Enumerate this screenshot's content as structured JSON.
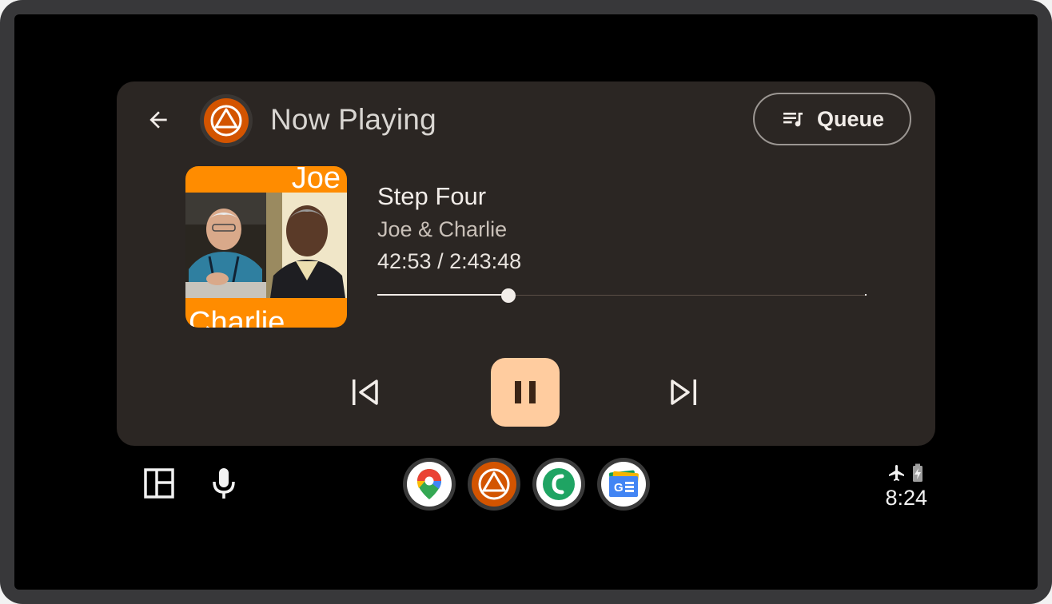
{
  "header": {
    "title": "Now Playing",
    "queue_label": "Queue"
  },
  "album_art": {
    "top_text": "Joe",
    "bottom_text": "Charlie",
    "background": "#ff8c00"
  },
  "track": {
    "title": "Step Four",
    "artist": "Joe & Charlie",
    "time": "42:53 / 2:43:48",
    "progress_fraction": 0.268
  },
  "controls": {
    "prev": "skip-previous-icon",
    "play_state": "pause-icon",
    "next": "skip-next-icon",
    "accent": "#ffcc9f"
  },
  "rail": {
    "left_buttons": [
      "dashboard-icon",
      "microphone-icon"
    ],
    "dock_apps": [
      {
        "name": "google-maps-icon",
        "bg": "#ffffff"
      },
      {
        "name": "app-triangle-icon",
        "bg": "#d35400"
      },
      {
        "name": "phone-app-icon",
        "bg": "#ffffff"
      },
      {
        "name": "google-news-icon",
        "bg": "#ffffff"
      }
    ]
  },
  "status": {
    "icons": [
      "airplane-mode-icon",
      "battery-charging-icon"
    ],
    "clock": "8:24"
  }
}
